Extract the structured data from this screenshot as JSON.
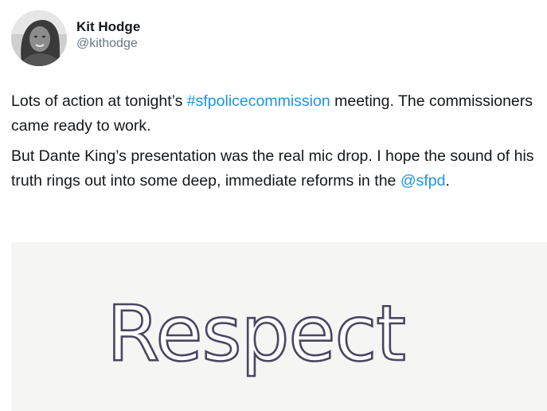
{
  "user": {
    "display_name": "Kit Hodge",
    "handle": "@kithodge"
  },
  "tweet": {
    "p1_a": "Lots of action at tonight’s ",
    "p1_hashtag": "#sfpolicecommission",
    "p1_b": " meeting. The commissioners came ready to work.",
    "p2_a": "But Dante King’s presentation was the real mic drop. I hope the sound of his truth rings out into some deep, immediate reforms in the ",
    "p2_mention": "@sfpd",
    "p2_b": "."
  },
  "media": {
    "caption_word": "Respect"
  },
  "colors": {
    "link": "#1b95e0",
    "handle": "#657786",
    "text": "#14171a",
    "media_bg": "#f5f5f4",
    "word_outline": "#4a4560"
  }
}
